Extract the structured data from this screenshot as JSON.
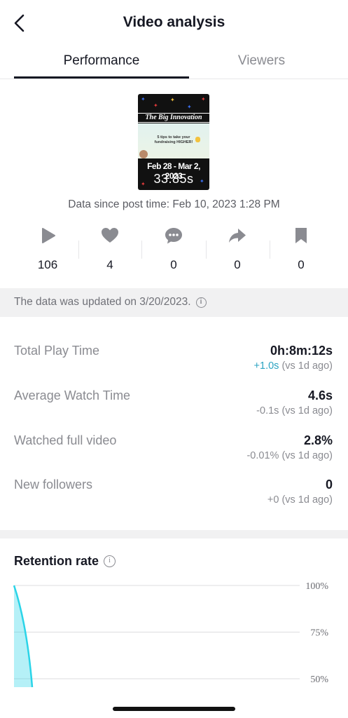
{
  "header": {
    "title": "Video analysis",
    "back_icon": "chevron-left-icon"
  },
  "tabs": [
    {
      "label": "Performance",
      "active": true
    },
    {
      "label": "Viewers",
      "active": false
    }
  ],
  "thumbnail": {
    "banner_text": "The Big Innovation",
    "tip_text": "5 tips to take your fundraising HIGHER!",
    "dates": "Feb 28 - Mar 2, 2023",
    "duration": "33.85s"
  },
  "data_since": "Data since post time: Feb 10, 2023 1:28 PM",
  "stats": [
    {
      "icon": "play-icon",
      "value": "106"
    },
    {
      "icon": "heart-icon",
      "value": "4"
    },
    {
      "icon": "comment-icon",
      "value": "0"
    },
    {
      "icon": "share-icon",
      "value": "0"
    },
    {
      "icon": "bookmark-icon",
      "value": "0"
    }
  ],
  "updated_notice": "The data was updated on 3/20/2023.",
  "metrics": [
    {
      "label": "Total Play Time",
      "value": "0h:8m:12s",
      "delta_value": "+1.0s",
      "delta_suffix": "(vs 1d ago)",
      "delta_positive": true
    },
    {
      "label": "Average Watch Time",
      "value": "4.6s",
      "delta_value": "-0.1s",
      "delta_suffix": "(vs 1d ago)",
      "delta_positive": false
    },
    {
      "label": "Watched full video",
      "value": "2.8%",
      "delta_value": "-0.01%",
      "delta_suffix": "(vs 1d ago)",
      "delta_positive": false
    },
    {
      "label": "New followers",
      "value": "0",
      "delta_value": "+0",
      "delta_suffix": "(vs 1d ago)",
      "delta_positive": false
    }
  ],
  "retention": {
    "title": "Retention rate",
    "chart_data": {
      "type": "area",
      "y_ticks": [
        "100%",
        "75%",
        "50%"
      ],
      "series": [
        {
          "values": [
            100,
            50
          ]
        }
      ],
      "color": "#2ad4e8"
    }
  },
  "colors": {
    "accent_positive": "#2aa3c2",
    "text_primary": "#161823",
    "text_secondary": "#8a8b91",
    "chart": "#2ad4e8"
  }
}
